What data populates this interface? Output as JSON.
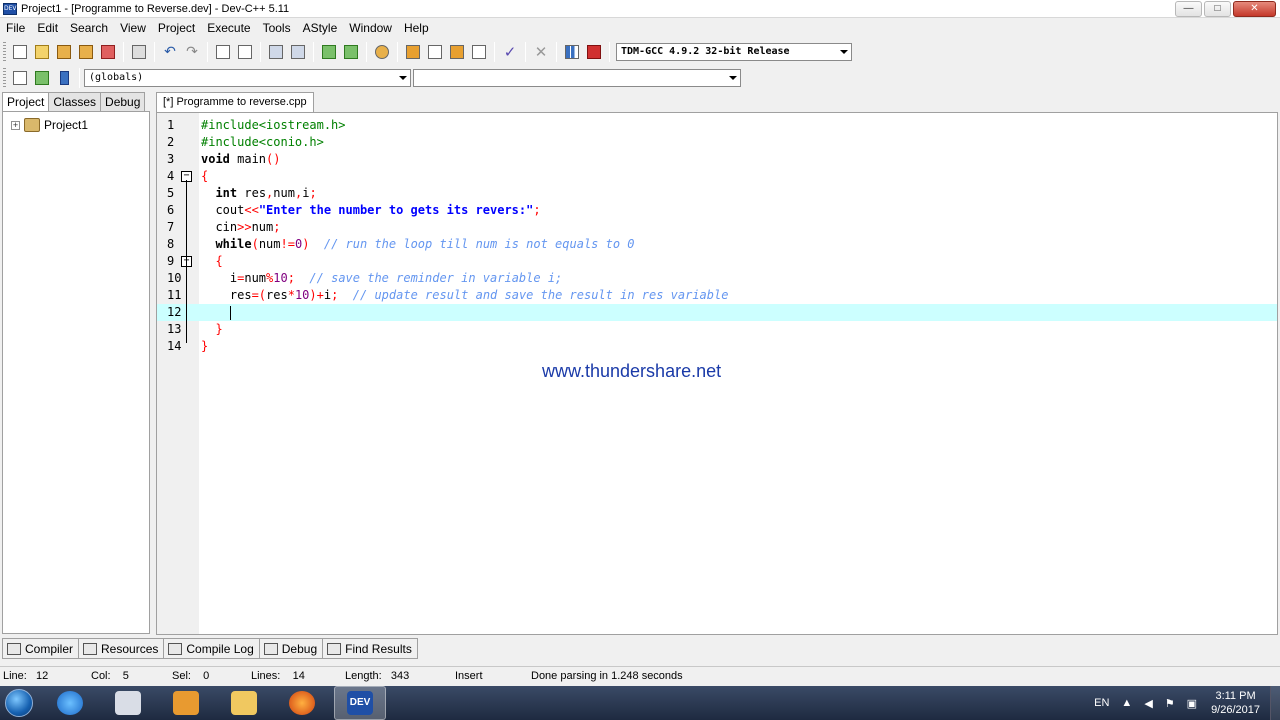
{
  "window": {
    "title": "Project1 - [Programme to Reverse.dev] - Dev-C++ 5.11",
    "icon_label": "DEV",
    "minimize": "—",
    "maximize": "□",
    "close": "✕"
  },
  "menu": [
    "File",
    "Edit",
    "Search",
    "View",
    "Project",
    "Execute",
    "Tools",
    "AStyle",
    "Window",
    "Help"
  ],
  "toolbar": {
    "compiler_select": "TDM-GCC 4.9.2 32-bit Release",
    "globals_select": "(globals)",
    "members_select": ""
  },
  "left_panel": {
    "tabs": [
      "Project",
      "Classes",
      "Debug"
    ],
    "active_tab": "Project",
    "tree": [
      {
        "label": "Project1",
        "expander": "+"
      }
    ]
  },
  "editor": {
    "tab_label": "[*] Programme to reverse.cpp",
    "current_line": 12,
    "lines": [
      {
        "n": "1",
        "parts": [
          {
            "t": "#include<iostream.h>",
            "c": "pp"
          }
        ]
      },
      {
        "n": "2",
        "parts": [
          {
            "t": "#include<conio.h>",
            "c": "pp"
          }
        ]
      },
      {
        "n": "3",
        "parts": [
          {
            "t": "void",
            "c": "kw"
          },
          {
            "t": " main",
            "c": ""
          },
          {
            "t": "()",
            "c": "sym"
          }
        ]
      },
      {
        "n": "4",
        "parts": [
          {
            "t": "{",
            "c": "sym"
          }
        ]
      },
      {
        "n": "5",
        "parts": [
          {
            "t": "  ",
            "c": ""
          },
          {
            "t": "int",
            "c": "kw"
          },
          {
            "t": " res",
            "c": ""
          },
          {
            "t": ",",
            "c": "sym"
          },
          {
            "t": "num",
            "c": ""
          },
          {
            "t": ",",
            "c": "sym"
          },
          {
            "t": "i",
            "c": ""
          },
          {
            "t": ";",
            "c": "sym"
          }
        ]
      },
      {
        "n": "6",
        "parts": [
          {
            "t": "  cout",
            "c": ""
          },
          {
            "t": "<<",
            "c": "sym"
          },
          {
            "t": "\"Enter the number to gets its revers:\"",
            "c": "str"
          },
          {
            "t": ";",
            "c": "sym"
          }
        ]
      },
      {
        "n": "7",
        "parts": [
          {
            "t": "  cin",
            "c": ""
          },
          {
            "t": ">>",
            "c": "sym"
          },
          {
            "t": "num",
            "c": ""
          },
          {
            "t": ";",
            "c": "sym"
          }
        ]
      },
      {
        "n": "8",
        "parts": [
          {
            "t": "  ",
            "c": ""
          },
          {
            "t": "while",
            "c": "kw"
          },
          {
            "t": "(",
            "c": "sym"
          },
          {
            "t": "num",
            "c": ""
          },
          {
            "t": "!=",
            "c": "sym"
          },
          {
            "t": "0",
            "c": "num"
          },
          {
            "t": ")",
            "c": "sym"
          },
          {
            "t": "  // run the loop till num is not equals to 0",
            "c": "cm"
          }
        ]
      },
      {
        "n": "9",
        "parts": [
          {
            "t": "  ",
            "c": ""
          },
          {
            "t": "{",
            "c": "sym"
          }
        ]
      },
      {
        "n": "10",
        "parts": [
          {
            "t": "    i",
            "c": ""
          },
          {
            "t": "=",
            "c": "sym"
          },
          {
            "t": "num",
            "c": ""
          },
          {
            "t": "%",
            "c": "sym"
          },
          {
            "t": "10",
            "c": "num"
          },
          {
            "t": ";",
            "c": "sym"
          },
          {
            "t": "  // save the reminder in variable i;",
            "c": "cm"
          }
        ]
      },
      {
        "n": "11",
        "parts": [
          {
            "t": "    res",
            "c": ""
          },
          {
            "t": "=(",
            "c": "sym"
          },
          {
            "t": "res",
            "c": ""
          },
          {
            "t": "*",
            "c": "sym"
          },
          {
            "t": "10",
            "c": "num"
          },
          {
            "t": ")+",
            "c": "sym"
          },
          {
            "t": "i",
            "c": ""
          },
          {
            "t": ";",
            "c": "sym"
          },
          {
            "t": "  // update result and save the result in res variable",
            "c": "cm"
          }
        ]
      },
      {
        "n": "12",
        "parts": [
          {
            "t": "    ",
            "c": ""
          }
        ]
      },
      {
        "n": "13",
        "parts": [
          {
            "t": "  ",
            "c": ""
          },
          {
            "t": "}",
            "c": "sym"
          }
        ]
      },
      {
        "n": "14",
        "parts": [
          {
            "t": "}",
            "c": "sym"
          }
        ]
      }
    ],
    "watermark": "www.thundershare.net"
  },
  "bottom_tabs": [
    "Compiler",
    "Resources",
    "Compile Log",
    "Debug",
    "Find Results"
  ],
  "status": {
    "line": "Line:   12",
    "col": "Col:    5",
    "sel": "Sel:    0",
    "lines": "Lines:    14",
    "length": "Length:   343",
    "mode": "Insert",
    "message": "Done parsing in 1.248 seconds"
  },
  "taskbar": {
    "lang": "EN",
    "time": "3:11 PM",
    "date": "9/26/2017",
    "active_app_label": "DEV"
  },
  "colors": {
    "preprocessor": "#008000",
    "symbol": "#ff0000",
    "string": "#0000ff",
    "comment": "#6496f0",
    "number": "#800080",
    "current_line": "#ccffff"
  }
}
